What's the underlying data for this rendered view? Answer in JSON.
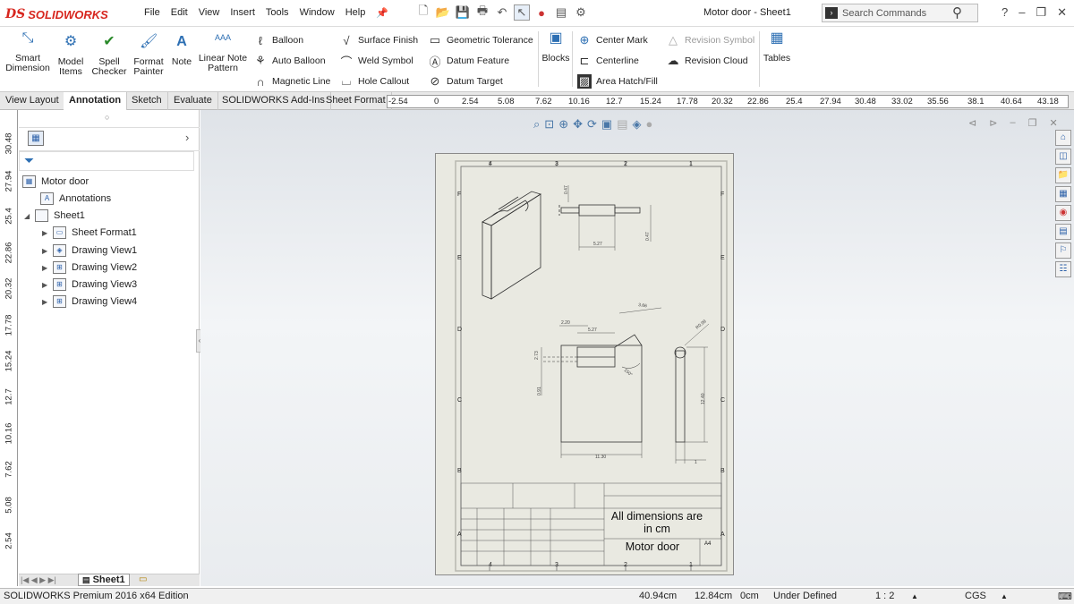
{
  "app": {
    "brand": "SOLIDWORKS",
    "edition": "SOLIDWORKS Premium 2016 x64 Edition"
  },
  "menu": [
    "File",
    "Edit",
    "View",
    "Insert",
    "Tools",
    "Window",
    "Help"
  ],
  "document_title": "Motor door - Sheet1",
  "search": {
    "placeholder": "Search Commands"
  },
  "ribbon": {
    "smart_dimension": "Smart Dimension",
    "model_items": "Model Items",
    "spell_checker": "Spell Checker",
    "format_painter": "Format Painter",
    "note": "Note",
    "linear_note_pattern": "Linear Note Pattern",
    "balloon": "Balloon",
    "auto_balloon": "Auto Balloon",
    "magnetic_line": "Magnetic Line",
    "surface_finish": "Surface Finish",
    "weld_symbol": "Weld Symbol",
    "hole_callout": "Hole Callout",
    "geometric_tolerance": "Geometric Tolerance",
    "datum_feature": "Datum Feature",
    "datum_target": "Datum Target",
    "blocks": "Blocks",
    "center_mark": "Center Mark",
    "centerline": "Centerline",
    "area_hatch_fill": "Area Hatch/Fill",
    "revision_symbol": "Revision Symbol",
    "revision_cloud": "Revision Cloud",
    "tables": "Tables"
  },
  "tabs": [
    "View Layout",
    "Annotation",
    "Sketch",
    "Evaluate",
    "SOLIDWORKS Add-Ins",
    "Sheet Format"
  ],
  "active_tab": "Annotation",
  "h_ruler": [
    "-2.54",
    "0",
    "2.54",
    "5.08",
    "7.62",
    "10.16",
    "12.7",
    "15.24",
    "17.78",
    "20.32",
    "22.86",
    "25.4",
    "27.94",
    "30.48",
    "33.02",
    "35.56",
    "38.1",
    "40.64",
    "43.18"
  ],
  "v_ruler": [
    "30.48",
    "27.94",
    "25.4",
    "22.86",
    "20.32",
    "17.78",
    "15.24",
    "12.7",
    "10.16",
    "7.62",
    "5.08",
    "2.54"
  ],
  "tree": {
    "root": "Motor door",
    "items": [
      {
        "label": "Annotations",
        "level": 1,
        "expander": false
      },
      {
        "label": "Sheet1",
        "level": 1,
        "expander": true,
        "expanded": true
      },
      {
        "label": "Sheet Format1",
        "level": 2,
        "expander": true
      },
      {
        "label": "Drawing View1",
        "level": 2,
        "expander": true
      },
      {
        "label": "Drawing View2",
        "level": 2,
        "expander": true
      },
      {
        "label": "Drawing View3",
        "level": 2,
        "expander": true
      },
      {
        "label": "Drawing View4",
        "level": 2,
        "expander": true
      }
    ]
  },
  "sheet_tab": "Sheet1",
  "drawing": {
    "zone_cols": [
      "4",
      "3",
      "2",
      "1"
    ],
    "zone_rows": [
      "F",
      "E",
      "D",
      "C",
      "B",
      "A"
    ],
    "dimensions": {
      "d_0_47_a": "0.47",
      "d_5_27_top": "5.27",
      "d_0_47_b": "0.47",
      "d_3_66": "3.66",
      "d_2_20": "2.20",
      "d_5_27_mid": "5.27",
      "d_2_73": "2.73",
      "d_0_91": "0.91",
      "d_r0_99": "R0.99",
      "d_12_40": "12.40",
      "d_11_30": "11.30",
      "d_1": "1",
      "d_angle": "150°"
    },
    "title_block": {
      "note": "All dimensions are in cm",
      "title": "Motor door",
      "size": "A4"
    }
  },
  "status": {
    "x": "40.94cm",
    "y": "12.84cm",
    "z": "0cm",
    "state": "Under Defined",
    "scale": "1 : 2",
    "units": "CGS"
  }
}
